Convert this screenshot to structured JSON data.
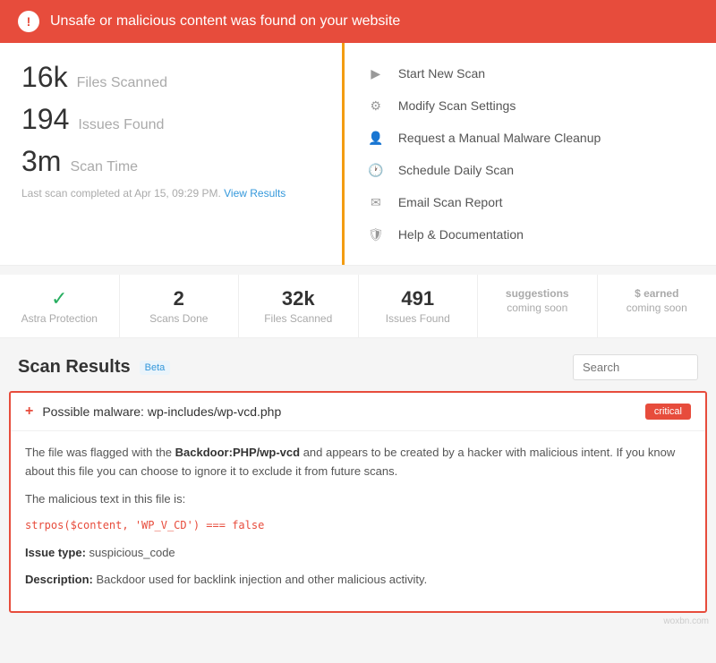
{
  "alert": {
    "icon": "!",
    "message": "Unsafe or malicious content was found on your website"
  },
  "stats": {
    "files_scanned": "16k",
    "files_scanned_label": "Files Scanned",
    "issues_found": "194",
    "issues_found_label": "Issues Found",
    "scan_time": "3m",
    "scan_time_label": "Scan Time",
    "last_scan": "Last scan completed at Apr 15, 09:29 PM.",
    "view_results": "View Results"
  },
  "actions": [
    {
      "icon": "▶",
      "label": "Start New Scan"
    },
    {
      "icon": "⚙",
      "label": "Modify Scan Settings"
    },
    {
      "icon": "👤",
      "label": "Request a Manual Malware Cleanup"
    },
    {
      "icon": "🕐",
      "label": "Schedule Daily Scan"
    },
    {
      "icon": "✉",
      "label": "Email Scan Report"
    },
    {
      "icon": "🛡",
      "label": "Help & Documentation"
    }
  ],
  "stats_bar": [
    {
      "value": "✓",
      "label": "Astra Protection",
      "type": "check"
    },
    {
      "value": "2",
      "label": "Scans Done",
      "type": "number"
    },
    {
      "value": "32k",
      "label": "Files Scanned",
      "type": "number"
    },
    {
      "value": "491",
      "label": "Issues Found",
      "type": "number"
    },
    {
      "value": "suggestions",
      "label": "coming soon",
      "type": "soon"
    },
    {
      "value": "$ earned",
      "label": "coming soon",
      "type": "soon"
    }
  ],
  "scan_results": {
    "title": "Scan Results",
    "beta": "Beta",
    "search_placeholder": "Search"
  },
  "malware_item": {
    "plus": "+",
    "filename": "Possible malware: wp-includes/wp-vcd.php",
    "severity": "critical",
    "description": "The file was flagged with the Backdoor:PHP/wp-vcd and appears to be created by a hacker with malicious intent. If you know about this file you can choose to ignore it to exclude it from future scans.",
    "malicious_text_label": "The malicious text in this file is:",
    "code": "strpos($content, 'WP_V_CD') === false",
    "issue_type_label": "Issue type:",
    "issue_type": "suspicious_code",
    "description_label": "Description:",
    "description_text": "Backdoor used for backlink injection and other malicious activity."
  },
  "watermark": "woxbn.com"
}
